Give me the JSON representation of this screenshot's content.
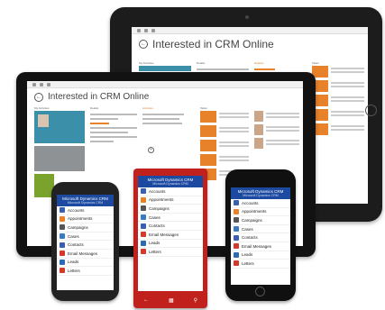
{
  "ipad": {
    "title": "Interested in CRM Online",
    "columns": [
      "My Activities",
      "Details",
      "Related",
      "Tasks"
    ]
  },
  "surface": {
    "title": "Interested in CRM Online",
    "columns": [
      "My Activities",
      "Details",
      "Activities",
      "Tasks"
    ]
  },
  "phones": {
    "app_title": "Microsoft Dynamics CRM",
    "app_subtitle": "Microsoft Dynamics CRM",
    "menu": [
      {
        "label": "Accounts",
        "color": "#3a5fb0"
      },
      {
        "label": "Appointments",
        "color": "#e8822a"
      },
      {
        "label": "Campaigns",
        "color": "#555555"
      },
      {
        "label": "Cases",
        "color": "#3a7ac0"
      },
      {
        "label": "Contacts",
        "color": "#3a5fb0"
      },
      {
        "label": "Email Messages",
        "color": "#d33a2c"
      },
      {
        "label": "Leads",
        "color": "#2b6cb0"
      },
      {
        "label": "Letters",
        "color": "#d33a2c"
      }
    ]
  },
  "colors": {
    "accent_orange": "#e8822a",
    "header_blue": "#1c4aa0",
    "tile_blue": "#3b8fa8",
    "tile_green": "#7aa32b",
    "phone_red": "#c0211d"
  }
}
